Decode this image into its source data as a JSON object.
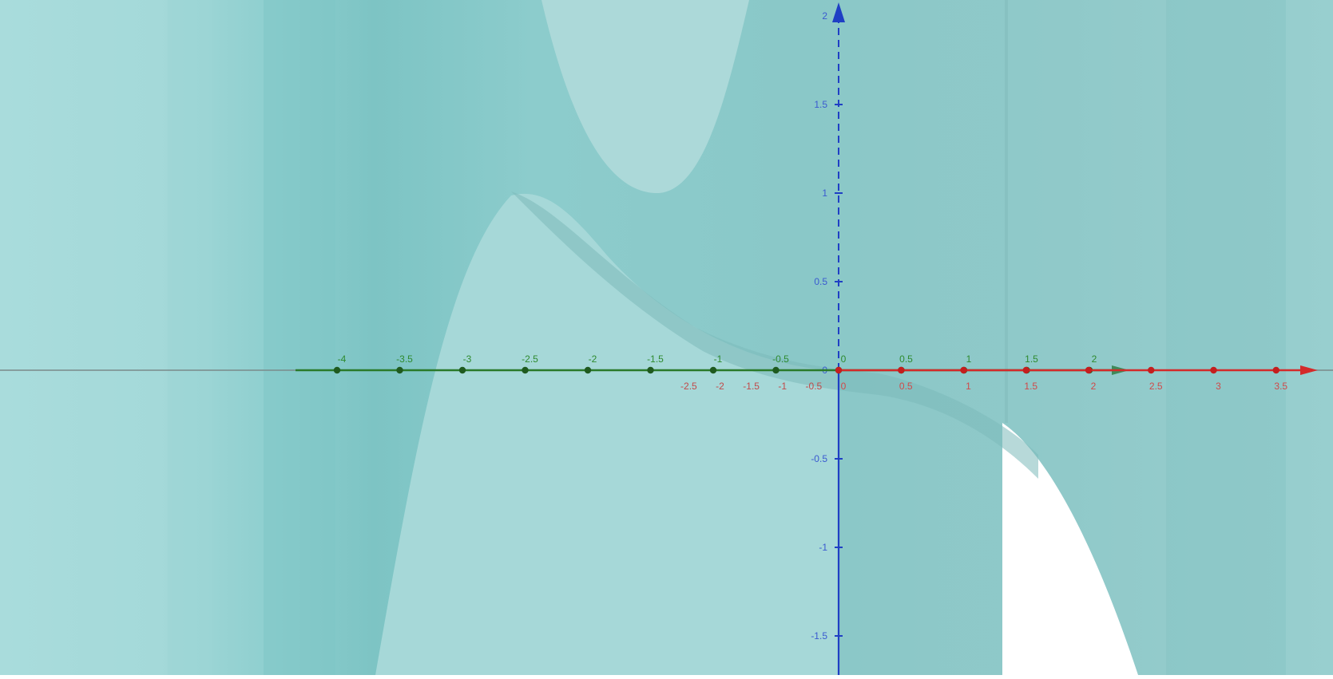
{
  "view": {
    "type": "3d-graphing-view",
    "surface_color": "#9ed6d6",
    "surface_shade_color": "#7fc2c2",
    "surface_highlight_color": "#b2e2e2"
  },
  "axes": {
    "x": {
      "color": "#d42a2a",
      "tick_values": [
        0,
        0.5,
        1,
        1.5,
        2,
        2.5,
        3,
        3.5
      ],
      "tick_labels": [
        "0",
        "0.5",
        "1",
        "1.5",
        "2",
        "2.5",
        "3",
        "3.5"
      ],
      "negative_tick_values": [
        -2.5,
        -2,
        -1.5,
        -1,
        -0.5
      ],
      "negative_tick_labels": [
        "-2.5",
        "-2",
        "-1.5",
        "-1",
        "-0.5"
      ]
    },
    "y": {
      "color": "#2a7a2a",
      "tick_values": [
        -4,
        -3.5,
        -3,
        -2.5,
        -2,
        -1.5,
        -1,
        -0.5,
        0,
        0.5,
        1,
        1.5,
        2
      ],
      "tick_labels": [
        "-4",
        "-3.5",
        "-3",
        "-2.5",
        "-2",
        "-1.5",
        "-1",
        "-0.5",
        "0",
        "0.5",
        "1",
        "1.5",
        "2"
      ]
    },
    "z": {
      "color": "#1f3fc4",
      "tick_values": [
        2,
        1.5,
        1,
        0.5,
        0,
        -0.5,
        -1,
        -1.5
      ],
      "tick_labels": [
        "2",
        "1.5",
        "1",
        "0.5",
        "0",
        "-0.5",
        "-1",
        "-1.5"
      ]
    }
  }
}
